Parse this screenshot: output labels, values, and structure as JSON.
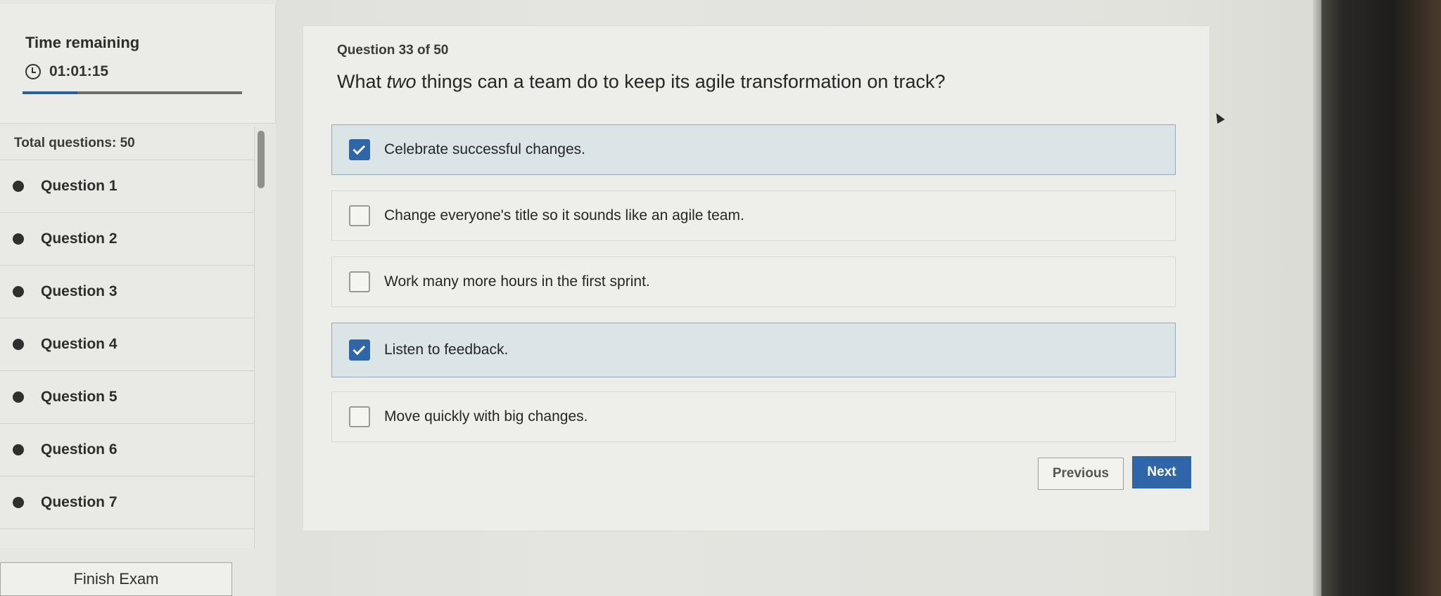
{
  "timer": {
    "label": "Time remaining",
    "value": "01:01:15",
    "progress_fraction": 0.25
  },
  "sidebar": {
    "total_label": "Total questions: 50",
    "questions": [
      {
        "label": "Question 1",
        "answered": true
      },
      {
        "label": "Question 2",
        "answered": true
      },
      {
        "label": "Question 3",
        "answered": true
      },
      {
        "label": "Question 4",
        "answered": true
      },
      {
        "label": "Question 5",
        "answered": true
      },
      {
        "label": "Question 6",
        "answered": true
      },
      {
        "label": "Question 7",
        "answered": true
      }
    ],
    "finish_label": "Finish Exam"
  },
  "question": {
    "number_label": "Question 33 of 50",
    "text_before": "What ",
    "text_emphasis": "two",
    "text_after": " things can a team do to keep its agile transformation on track?",
    "options": [
      {
        "label": "Celebrate successful changes.",
        "selected": true
      },
      {
        "label": "Change everyone's title so it sounds like an agile team.",
        "selected": false
      },
      {
        "label": "Work many more hours in the first sprint.",
        "selected": false
      },
      {
        "label": "Listen to feedback.",
        "selected": true
      },
      {
        "label": "Move quickly with big changes.",
        "selected": false
      }
    ]
  },
  "nav": {
    "previous_label": "Previous",
    "next_label": "Next"
  },
  "colors": {
    "accent": "#2f66a8",
    "selected_option_bg": "#dbe4e6"
  }
}
